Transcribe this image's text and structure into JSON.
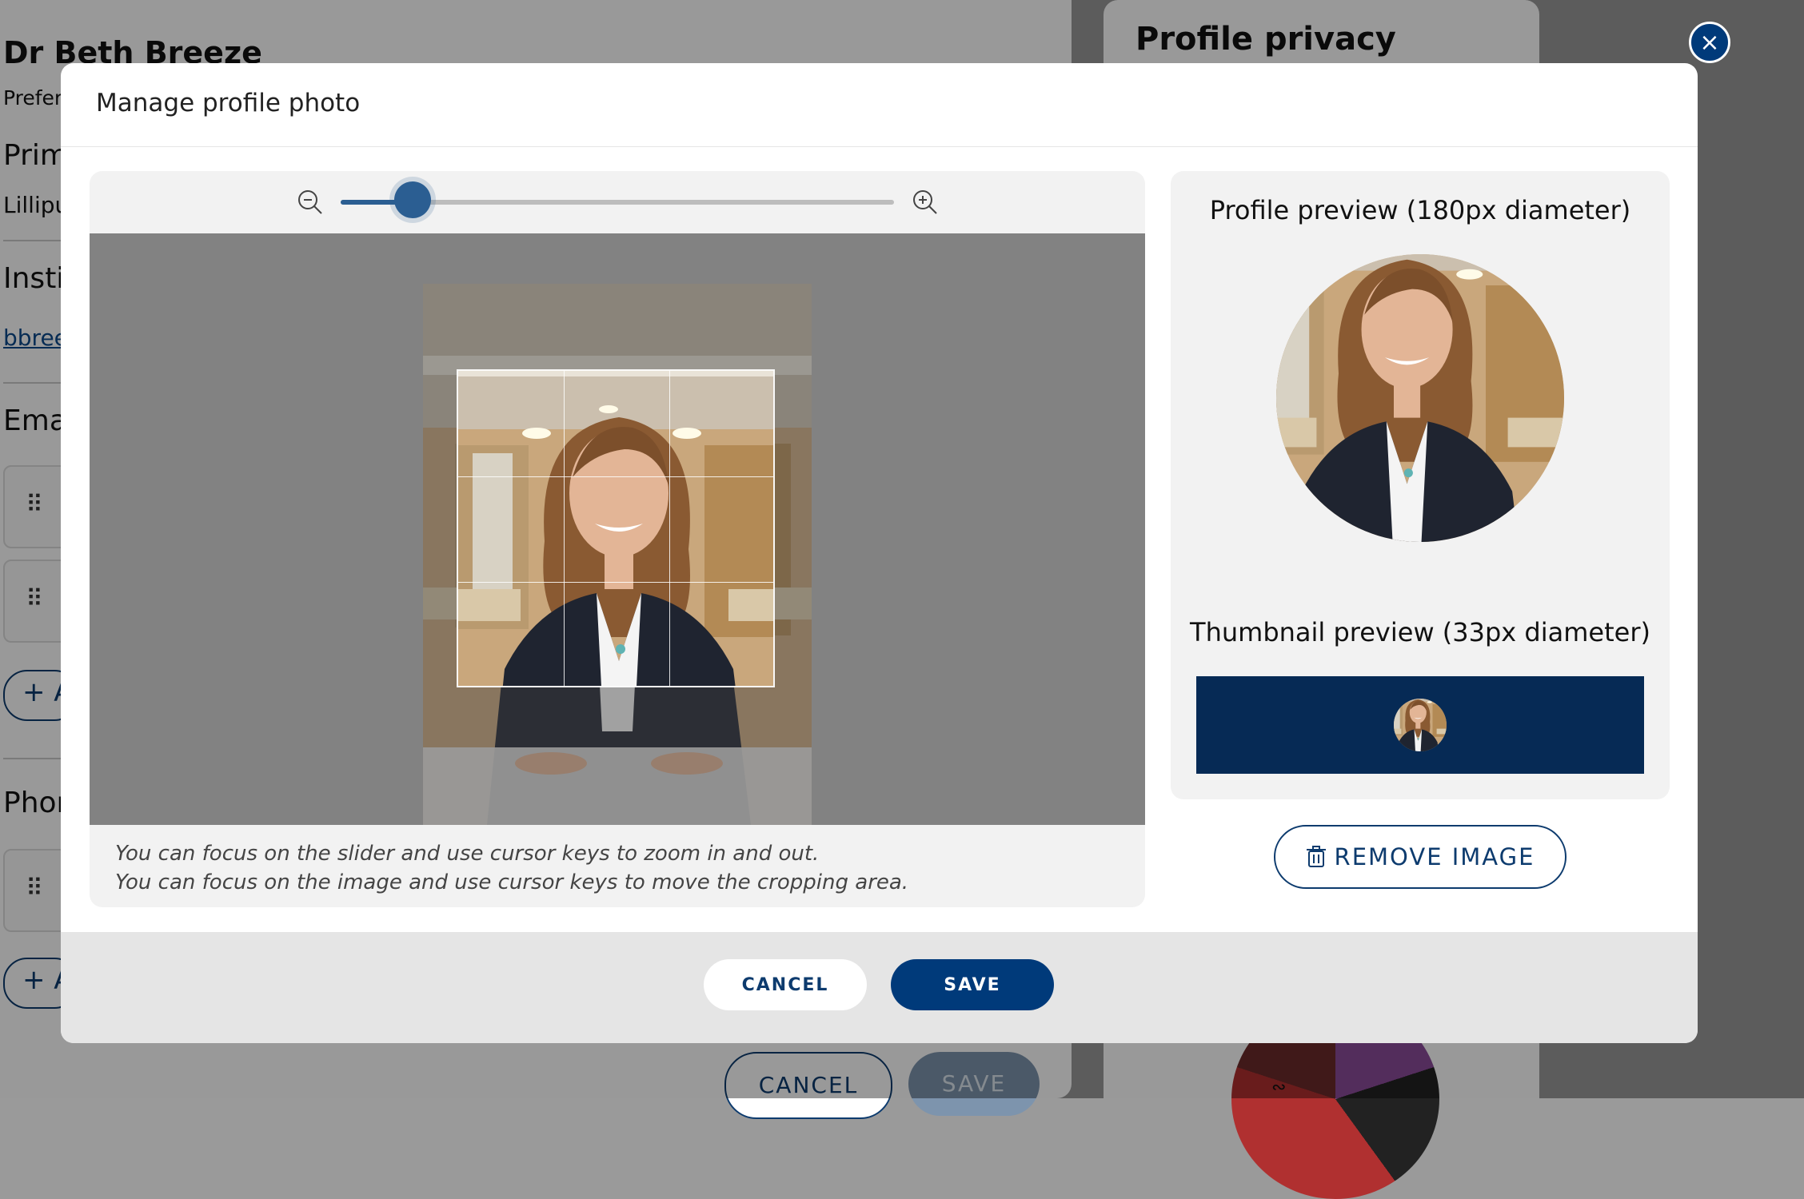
{
  "background": {
    "name": "Dr Beth Breeze",
    "preferred_partial": "Prefer",
    "primary_partial": "Prim",
    "primary_value_partial": "Lillipu",
    "institution_partial": "Insti",
    "institution_link_partial": "bbree",
    "email_partial": "Ema",
    "phone_partial": "Phor",
    "add_partial": "+ A",
    "privacy_title": "Profile privacy",
    "cancel_label": "CANCEL",
    "save_label": "SAVE",
    "chart_glyph": "∾"
  },
  "modal": {
    "title": "Manage profile photo",
    "close_icon": "×",
    "zoom": {
      "level": 0.13,
      "zoom_out_icon": "zoom-out-icon",
      "zoom_in_icon": "zoom-in-icon"
    },
    "hint_line1": "You can focus on the slider and use cursor keys to zoom in and out.",
    "hint_line2": "You can focus on the image and use cursor keys to move the cropping area.",
    "profile_preview_title": "Profile preview (180px diameter)",
    "thumbnail_preview_title": "Thumbnail preview (33px diameter)",
    "remove_image_label": "REMOVE IMAGE",
    "cancel_label": "CANCEL",
    "save_label": "SAVE"
  },
  "colors": {
    "primary": "#003a7a",
    "slider": "#2b5e92",
    "thumbnail_bar": "#062a55"
  }
}
